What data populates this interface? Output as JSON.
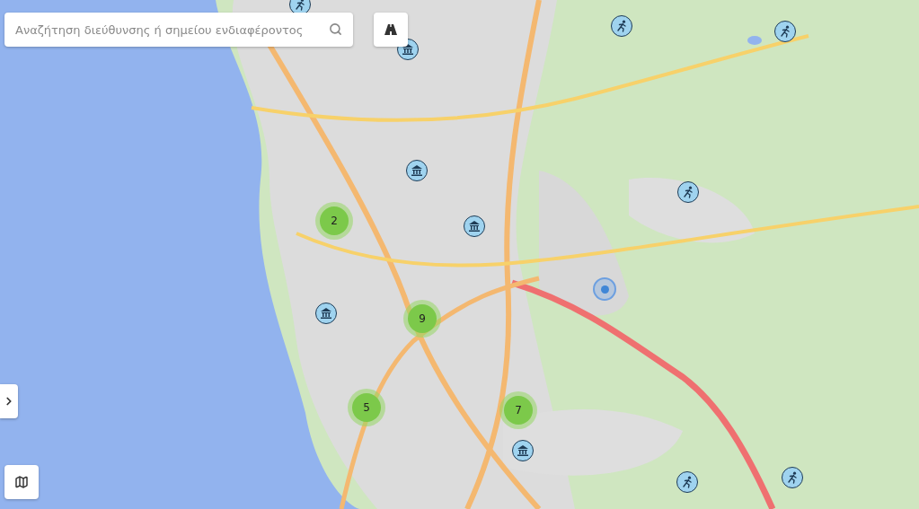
{
  "search": {
    "placeholder": "Αναζήτηση διεύθυνσης ή σημείου ενδιαφέροντος"
  },
  "clusters": [
    {
      "count": "2"
    },
    {
      "count": "9"
    },
    {
      "count": "5"
    },
    {
      "count": "7"
    }
  ]
}
